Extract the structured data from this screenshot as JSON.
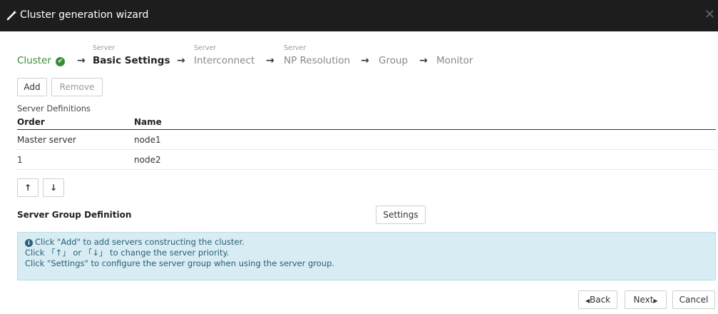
{
  "window": {
    "title": "Cluster generation wizard"
  },
  "steps": {
    "sub_label": "Server",
    "items": [
      "Cluster",
      "Basic Settings",
      "Interconnect",
      "NP Resolution",
      "Group",
      "Monitor"
    ]
  },
  "toolbar": {
    "add_label": "Add",
    "remove_label": "Remove"
  },
  "server_definitions": {
    "label": "Server Definitions",
    "columns": [
      "Order",
      "Name"
    ],
    "rows": [
      {
        "order": "Master server",
        "name": "node1"
      },
      {
        "order": "1",
        "name": "node2"
      }
    ]
  },
  "priority": {
    "up_label": "↑",
    "down_label": "↓"
  },
  "server_group": {
    "label": "Server Group Definition",
    "settings_label": "Settings"
  },
  "info": {
    "line1": "Click \"Add\" to add servers constructing the cluster.",
    "line2": "Click 「↑」 or 「↓」 to change the server priority.",
    "line3": "Click \"Settings\" to configure the server group when using the server group."
  },
  "footer": {
    "back_label": "Back",
    "next_label": "Next",
    "cancel_label": "Cancel"
  }
}
